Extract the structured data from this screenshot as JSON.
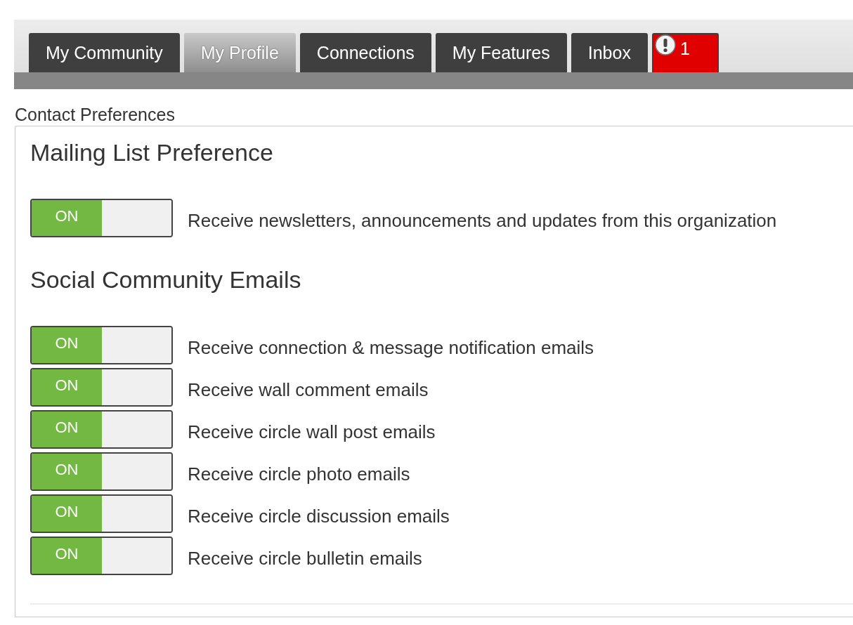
{
  "tabs": [
    {
      "kind": "tab",
      "label": "My Community",
      "selected": false
    },
    {
      "kind": "tab",
      "label": "My Profile",
      "selected": true
    },
    {
      "kind": "tab",
      "label": "Connections",
      "selected": false
    },
    {
      "kind": "tab",
      "label": "My Features",
      "selected": false
    },
    {
      "kind": "tab",
      "label": "Inbox",
      "selected": false
    },
    {
      "kind": "alert",
      "label": "1",
      "selected": false
    }
  ],
  "page_title": "Contact Preferences",
  "sections": [
    {
      "heading": "Mailing List Preference",
      "items": [
        {
          "switch_label": "ON",
          "on": true,
          "text": "Receive newsletters, announcements and updates from this organization"
        }
      ]
    },
    {
      "heading": "Social Community Emails",
      "items": [
        {
          "switch_label": "ON",
          "on": true,
          "text": "Receive connection & message notification emails"
        },
        {
          "switch_label": "ON",
          "on": true,
          "text": "Receive wall comment emails"
        },
        {
          "switch_label": "ON",
          "on": true,
          "text": "Receive circle wall post emails"
        },
        {
          "switch_label": "ON",
          "on": true,
          "text": "Receive circle photo emails"
        },
        {
          "switch_label": "ON",
          "on": true,
          "text": "Receive circle discussion emails"
        },
        {
          "switch_label": "ON",
          "on": true,
          "text": "Receive circle bulletin emails"
        }
      ]
    }
  ]
}
